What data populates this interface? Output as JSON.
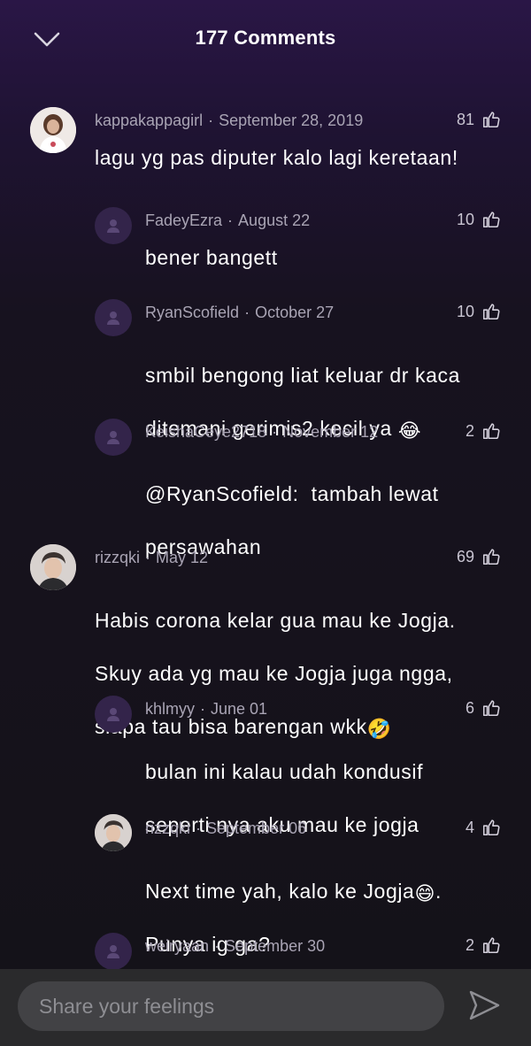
{
  "header": {
    "title": "177 Comments",
    "back_icon": "chevron-down-icon"
  },
  "comments": [
    {
      "user": "kappakappagirl",
      "date": "September 28, 2019",
      "likes": "81",
      "text": "lagu yg pas diputer kalo lagi keretaan!",
      "avatar": "photo"
    },
    {
      "user": "FadeyEzra",
      "date": "August 22",
      "likes": "10",
      "text": "bener bangett",
      "avatar": "placeholder",
      "reply": true
    },
    {
      "user": "RyanScofield",
      "date": "October 27",
      "likes": "10",
      "text_line1": "smbil bengong liat keluar dr kaca",
      "text_line2": "ditemani gerimis2 kecil ya",
      "emoji": "😂",
      "avatar": "placeholder",
      "reply": true
    },
    {
      "user": "KeishaCeye2718",
      "date": "November 12",
      "likes": "2",
      "text_line1": "@RyanScofield:  tambah lewat",
      "text_line2": "persawahan",
      "avatar": "placeholder",
      "reply": true
    },
    {
      "user": "rizzqki",
      "date": "May 12",
      "likes": "69",
      "text_line1": "Habis corona kelar gua mau ke Jogja.",
      "text_line2": "Skuy ada yg mau ke Jogja juga ngga,",
      "text_line3": "siapa tau bisa barengan wkk",
      "emoji": "🤣",
      "avatar": "photo"
    },
    {
      "user": "khlmyy",
      "date": "June 01",
      "likes": "6",
      "text_line1": "bulan ini kalau udah kondusif",
      "text_line2": "seperti nya aku mau ke jogja",
      "avatar": "placeholder",
      "reply": true
    },
    {
      "user": "rizzqki",
      "date": "September 06",
      "likes": "4",
      "text_line1": "Next time yah, kalo ke Jogja",
      "emoji": "😄",
      "text_line1_end": ".",
      "text_line2": "Punya ig ga?",
      "avatar": "photo",
      "reply": true
    },
    {
      "user": "weiryaan",
      "date": "September 30",
      "likes": "2",
      "avatar": "placeholder",
      "reply": true
    }
  ],
  "separator": "·",
  "composer": {
    "placeholder": "Share your feelings",
    "send_icon": "send-icon"
  },
  "colors": {
    "background_top": "#2a1646",
    "background": "#141218",
    "meta_text": "#a9a4b4",
    "input_bg": "#424245",
    "bottom_bar": "#2a2a2c"
  }
}
